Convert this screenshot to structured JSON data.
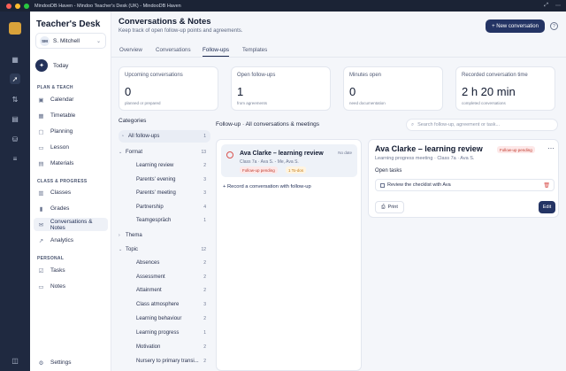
{
  "window": {
    "title": "MindooDB Haven - Mindoo Teacher's Desk (UK) - MindooDB Haven"
  },
  "brand": {
    "name_prefix": "Teacher's",
    "name_suffix": "Desk"
  },
  "user": {
    "initials": "SM",
    "name": "S. Mitchell"
  },
  "today": {
    "label": "Today"
  },
  "sidebar": {
    "sections": {
      "plan": "PLAN & TEACH",
      "classes": "CLASS & PROGRESS",
      "personal": "PERSONAL"
    },
    "plan_items": [
      {
        "label": "Calendar",
        "icon": "calendar-icon"
      },
      {
        "label": "Timetable",
        "icon": "timetable-icon"
      },
      {
        "label": "Planning",
        "icon": "planning-icon"
      },
      {
        "label": "Lesson",
        "icon": "lesson-icon"
      },
      {
        "label": "Materials",
        "icon": "materials-icon"
      }
    ],
    "class_items": [
      {
        "label": "Classes",
        "icon": "classes-icon"
      },
      {
        "label": "Grades",
        "icon": "grades-icon"
      },
      {
        "label": "Conversations & Notes",
        "icon": "conversations-icon",
        "active": true
      },
      {
        "label": "Analytics",
        "icon": "analytics-icon"
      }
    ],
    "personal_items": [
      {
        "label": "Tasks",
        "icon": "tasks-icon"
      },
      {
        "label": "Notes",
        "icon": "notes-icon"
      }
    ],
    "settings": "Settings"
  },
  "header": {
    "title": "Conversations & Notes",
    "subtitle": "Keep track of open follow-up points and agreements.",
    "new_button": "+ New conversation"
  },
  "tabs": [
    "Overview",
    "Conversations",
    "Follow-ups",
    "Templates"
  ],
  "active_tab": "Follow-ups",
  "stats": [
    {
      "label": "Upcoming conversations",
      "value": "0",
      "sub": "planned or prepared"
    },
    {
      "label": "Open follow-ups",
      "value": "1",
      "sub": "from agreements"
    },
    {
      "label": "Minutes open",
      "value": "0",
      "sub": "need documentation"
    },
    {
      "label": "Recorded conversation time",
      "value": "2 h 20 min",
      "sub": "completed conversations"
    }
  ],
  "categories": {
    "title": "Categories",
    "all": {
      "label": "All follow-ups",
      "count": "1"
    },
    "format": {
      "label": "Format",
      "count": "13",
      "items": [
        {
          "label": "Learning review",
          "count": "2"
        },
        {
          "label": "Parents' evening",
          "count": "3"
        },
        {
          "label": "Parents' meeting",
          "count": "3"
        },
        {
          "label": "Partnership",
          "count": "4"
        },
        {
          "label": "Teamgespräch",
          "count": "1"
        }
      ]
    },
    "thema": {
      "label": "Thema"
    },
    "topic": {
      "label": "Topic",
      "count": "12",
      "items": [
        {
          "label": "Absences",
          "count": "2"
        },
        {
          "label": "Assessment",
          "count": "2"
        },
        {
          "label": "Attainment",
          "count": "2"
        },
        {
          "label": "Class atmosphere",
          "count": "3"
        },
        {
          "label": "Learning behaviour",
          "count": "2"
        },
        {
          "label": "Learning progress",
          "count": "1"
        },
        {
          "label": "Motivation",
          "count": "2"
        },
        {
          "label": "Nursery to primary transi...",
          "count": "2"
        }
      ]
    }
  },
  "list": {
    "heading": "Follow-up · All conversations & meetings",
    "search_placeholder": "Search follow-up, agreement or task...",
    "item": {
      "title": "Ava Clarke – learning review",
      "meta": "Class 7a · Ava S. - Me, Ava S.",
      "date": "No date",
      "badge_status": "Follow-up pending",
      "badge_todo": "1 To-dos"
    },
    "record_link": "+ Record a conversation with follow-up"
  },
  "detail": {
    "title": "Ava Clarke – learning review",
    "meta": "Learning progress meeting · Class 7a · Ava S.",
    "badge": "Follow-up pending",
    "more": "⋯",
    "open_tasks_label": "Open tasks",
    "task": "Review the checklist with Ava",
    "print": "Print",
    "edit": "Edit"
  }
}
